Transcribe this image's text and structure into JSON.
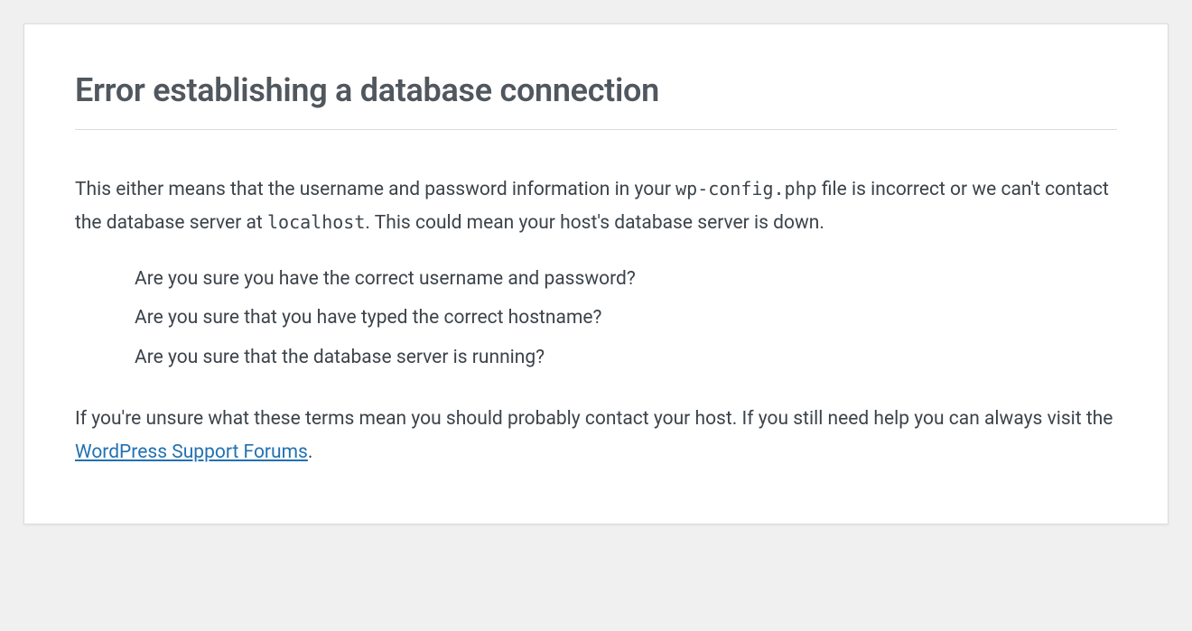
{
  "heading": "Error establishing a database connection",
  "intro": {
    "part1": "This either means that the username and password information in your ",
    "code1": "wp-config.php",
    "part2": " file is incorrect or we can't contact the database server at ",
    "code2": "localhost",
    "part3": ". This could mean your host's database server is down."
  },
  "checklist": [
    "Are you sure you have the correct username and password?",
    "Are you sure that you have typed the correct hostname?",
    "Are you sure that the database server is running?"
  ],
  "footer": {
    "part1": "If you're unsure what these terms mean you should probably contact your host. If you still need help you can always visit the ",
    "link_text": "WordPress Support Forums",
    "part2": "."
  }
}
